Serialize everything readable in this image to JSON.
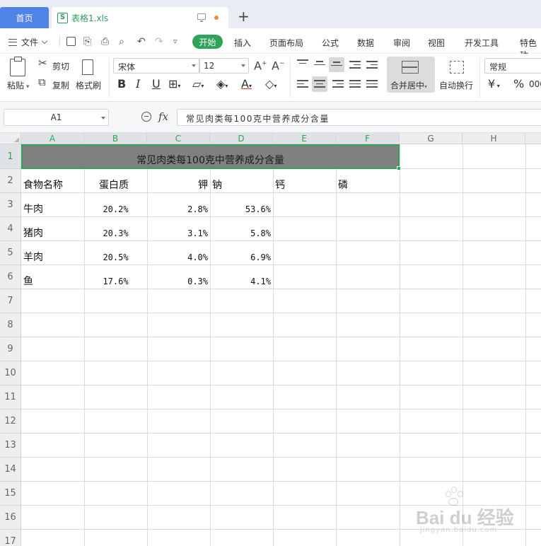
{
  "tabs": {
    "home_label": "首页",
    "file_label": "表格1.xls",
    "new_tab_symbol": "+"
  },
  "menu": {
    "file_label": "文件",
    "items": [
      "开始",
      "插入",
      "页面布局",
      "公式",
      "数据",
      "审阅",
      "视图",
      "开发工具",
      "特色功"
    ],
    "active_index": 0
  },
  "ribbon": {
    "paste_label": "粘贴",
    "cut_label": "剪切",
    "copy_label": "复制",
    "format_painter_label": "格式刷",
    "font_name": "宋体",
    "font_size": "12",
    "bold": "B",
    "italic": "I",
    "underline": "U",
    "merge_label": "合并居中",
    "wrap_label": "自动换行",
    "number_format": "常规",
    "currency_symbol": "¥",
    "percent_symbol": "%"
  },
  "formula_bar": {
    "cell_ref": "A1",
    "fx_label": "fx",
    "content": "常见肉类每100克中营养成分含量"
  },
  "sheet": {
    "columns": [
      "A",
      "B",
      "C",
      "D",
      "E",
      "F",
      "G",
      "H"
    ],
    "rows": [
      "1",
      "2",
      "3",
      "4",
      "5",
      "6",
      "7",
      "8",
      "9",
      "10",
      "11",
      "12",
      "13",
      "14",
      "15",
      "16",
      "17"
    ],
    "title": "常见肉类每100克中营养成分含量",
    "headers": [
      "食物名称",
      "蛋白质",
      "钾",
      "钠",
      "钙",
      "磷"
    ],
    "data": [
      [
        "牛肉",
        "20.2%",
        "2.8%",
        "53.6%"
      ],
      [
        "猪肉",
        "20.3%",
        "3.1%",
        "5.8%"
      ],
      [
        "羊肉",
        "20.5%",
        "4.0%",
        "6.9%"
      ],
      [
        "鱼",
        "17.6%",
        "0.3%",
        "4.1%"
      ]
    ]
  },
  "watermark": {
    "brand": "Bai du 经验",
    "url": "jingyan.baidu.com"
  },
  "colors": {
    "accent_green": "#2fa35a",
    "home_tab_blue": "#4f83e6",
    "merged_fill": "#808080"
  }
}
